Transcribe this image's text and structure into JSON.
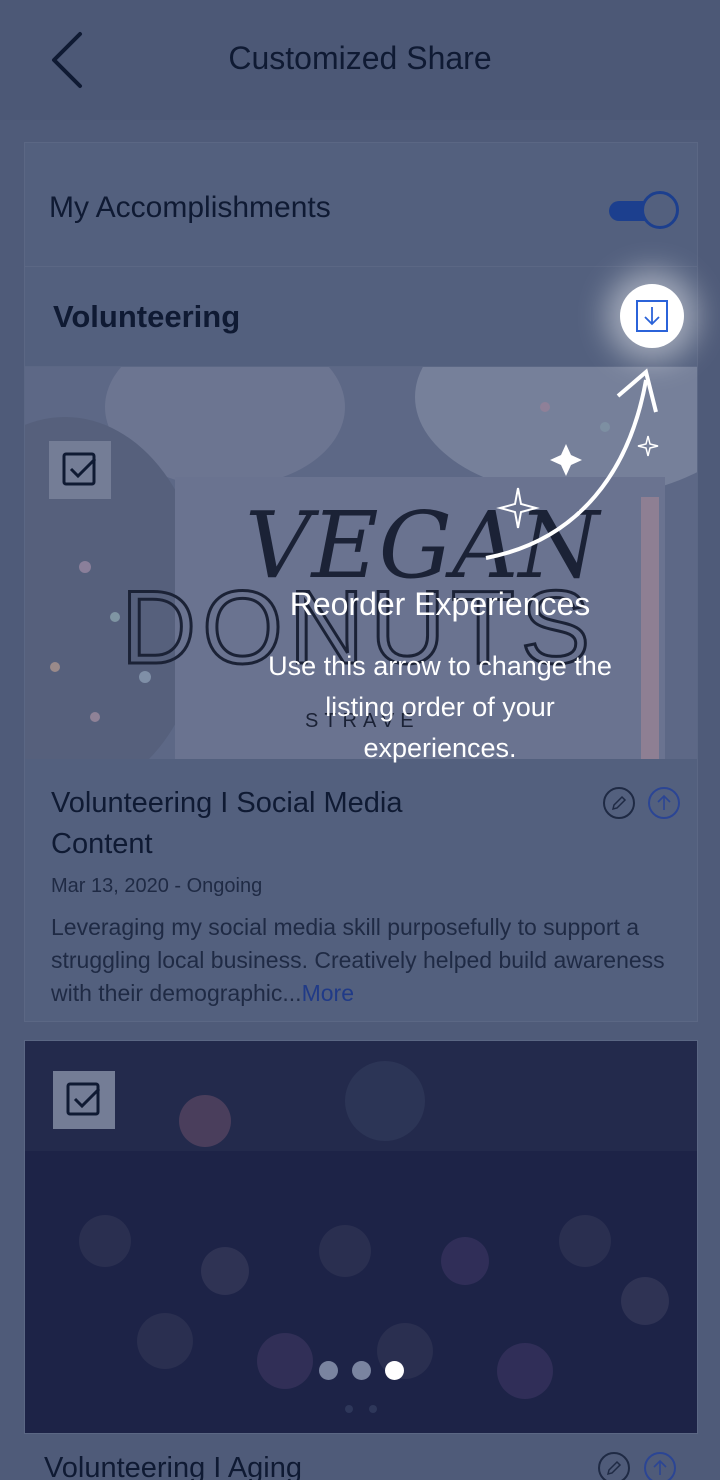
{
  "header": {
    "title": "Customized Share",
    "back_icon": "chevron-left-icon"
  },
  "accomplishments": {
    "label": "My Accomplishments",
    "toggle_on": true
  },
  "section": {
    "label": "Volunteering"
  },
  "cards": [
    {
      "title": "Volunteering I Social Media Content",
      "date": "Mar 13, 2020 - Ongoing",
      "description": "Leveraging my social media skill purposefully to support a struggling local business. Creatively helped build awareness with their demographic...",
      "more": "More",
      "image_text_top": "VEGAN",
      "image_text_main": "DONUTS",
      "image_text_small": "STRAVE"
    },
    {
      "title": "Volunteering I Aging"
    }
  ],
  "carousel": {
    "dot_count": 3,
    "active_index": 2
  },
  "tooltip": {
    "title": "Reorder Experiences",
    "text": "Use this arrow to change the listing order of your experiences."
  },
  "colors": {
    "accent": "#2b63d9",
    "overlay": "#4f5b79",
    "toggle": "#1c3f8e"
  }
}
